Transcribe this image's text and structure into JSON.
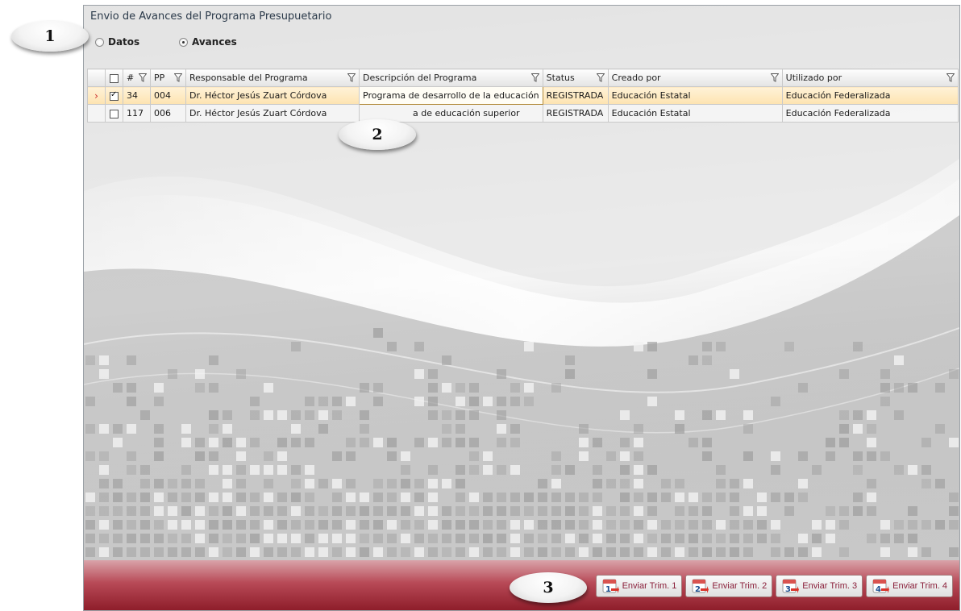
{
  "window": {
    "title": "Envio de Avances del Programa Presupuetario"
  },
  "radios": [
    {
      "label": "Datos",
      "selected": false
    },
    {
      "label": "Avances",
      "selected": true
    }
  ],
  "grid": {
    "columns": [
      "#",
      "PP",
      "Responsable del Programa",
      "Descripción del Programa",
      "Status",
      "Creado por",
      "Utilizado por"
    ],
    "rows": [
      {
        "checked": true,
        "selected": true,
        "num": "34",
        "pp": "004",
        "responsable": "Dr. Héctor Jesús Zuart Córdova",
        "descripcion": "Programa de desarrollo de la educación",
        "status": "REGISTRADA",
        "creado": "Educación Estatal",
        "utilizado": "Educación Federalizada"
      },
      {
        "checked": false,
        "selected": false,
        "num": "117",
        "pp": "006",
        "responsable": "Dr. Héctor Jesús Zuart Córdova",
        "descripcion": "a de educación superior",
        "status": "REGISTRADA",
        "creado": "Educación Estatal",
        "utilizado": "Educación Federalizada"
      }
    ],
    "row_indicator": "›"
  },
  "buttons": [
    {
      "label": "Enviar Trim. 1",
      "icon": "calendar-trim-1-icon",
      "num": "1"
    },
    {
      "label": "Enviar Trim. 2",
      "icon": "calendar-trim-2-icon",
      "num": "2"
    },
    {
      "label": "Enviar Trim. 3",
      "icon": "calendar-trim-3-icon",
      "num": "3"
    },
    {
      "label": "Enviar Trim. 4",
      "icon": "calendar-trim-4-icon",
      "num": "4"
    }
  ],
  "callouts": [
    "1",
    "2",
    "3"
  ],
  "colors": {
    "accent": "#8e1d2a",
    "selection": "#fde3b0",
    "button_text": "#8a1f3a"
  }
}
